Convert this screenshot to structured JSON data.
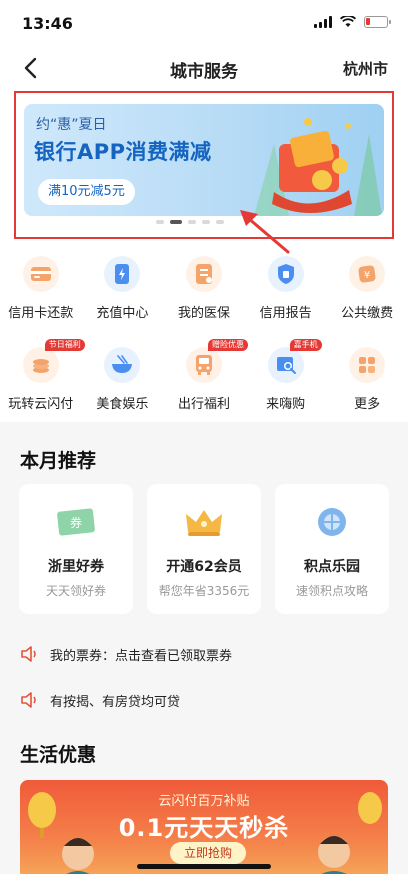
{
  "status": {
    "time": "13:46"
  },
  "nav": {
    "title": "城市服务",
    "city": "杭州市"
  },
  "banner": {
    "subtitle": "约“惠”夏日",
    "title": "银行APP消费满减",
    "pill": "满10元减5元",
    "active_dot": 2,
    "dot_count": 5
  },
  "services": [
    [
      {
        "label": "信用卡还款",
        "icon": "credit-card-icon",
        "color": "#f4a46a",
        "bg": "#fff1e6"
      },
      {
        "label": "充值中心",
        "icon": "phone-recharge-icon",
        "color": "#4a8ff0",
        "bg": "#e8f1fe"
      },
      {
        "label": "我的医保",
        "icon": "medical-insurance-icon",
        "color": "#f4a46a",
        "bg": "#fff1e6"
      },
      {
        "label": "信用报告",
        "icon": "credit-report-icon",
        "color": "#4a8ff0",
        "bg": "#e8f1fe"
      },
      {
        "label": "公共缴费",
        "icon": "public-payment-icon",
        "color": "#f4a46a",
        "bg": "#fff1e6"
      }
    ],
    [
      {
        "label": "玩转云闪付",
        "icon": "coins-icon",
        "color": "#f4a46a",
        "bg": "#fff1e6",
        "badge": "节日福利"
      },
      {
        "label": "美食娱乐",
        "icon": "food-bowl-icon",
        "color": "#4a8ff0",
        "bg": "#e8f1fe"
      },
      {
        "label": "出行福利",
        "icon": "bus-icon",
        "color": "#f4a46a",
        "bg": "#fff1e6",
        "badge": "赠险优惠"
      },
      {
        "label": "来嗨购",
        "icon": "shopping-search-icon",
        "color": "#4a8ff0",
        "bg": "#e8f1fe",
        "badge": "嘉手机"
      },
      {
        "label": "更多",
        "icon": "more-grid-icon",
        "color": "#f4a46a",
        "bg": "#fff1e6"
      }
    ]
  ],
  "monthly": {
    "title": "本月推荐",
    "cards": [
      {
        "title": "浙里好券",
        "desc": "天天领好券",
        "icon": "coupon-icon",
        "icon_text": "券"
      },
      {
        "title": "开通62会员",
        "desc": "帮您年省3356元",
        "icon": "crown-icon"
      },
      {
        "title": "积点乐园",
        "desc": "速领积点攻略",
        "icon": "points-icon"
      }
    ]
  },
  "notices": [
    {
      "text": "我的票券：点击查看已领取票券"
    },
    {
      "text": "有按揭、有房贷均可贷"
    }
  ],
  "life": {
    "title": "生活优惠",
    "promo": {
      "subtitle": "云闪付百万补贴",
      "title": "0.1元天天秒杀",
      "button": "立即抢购"
    }
  },
  "colors": {
    "accent": "#e53935",
    "blue": "#1565c0",
    "promo": "#f05a3a"
  }
}
